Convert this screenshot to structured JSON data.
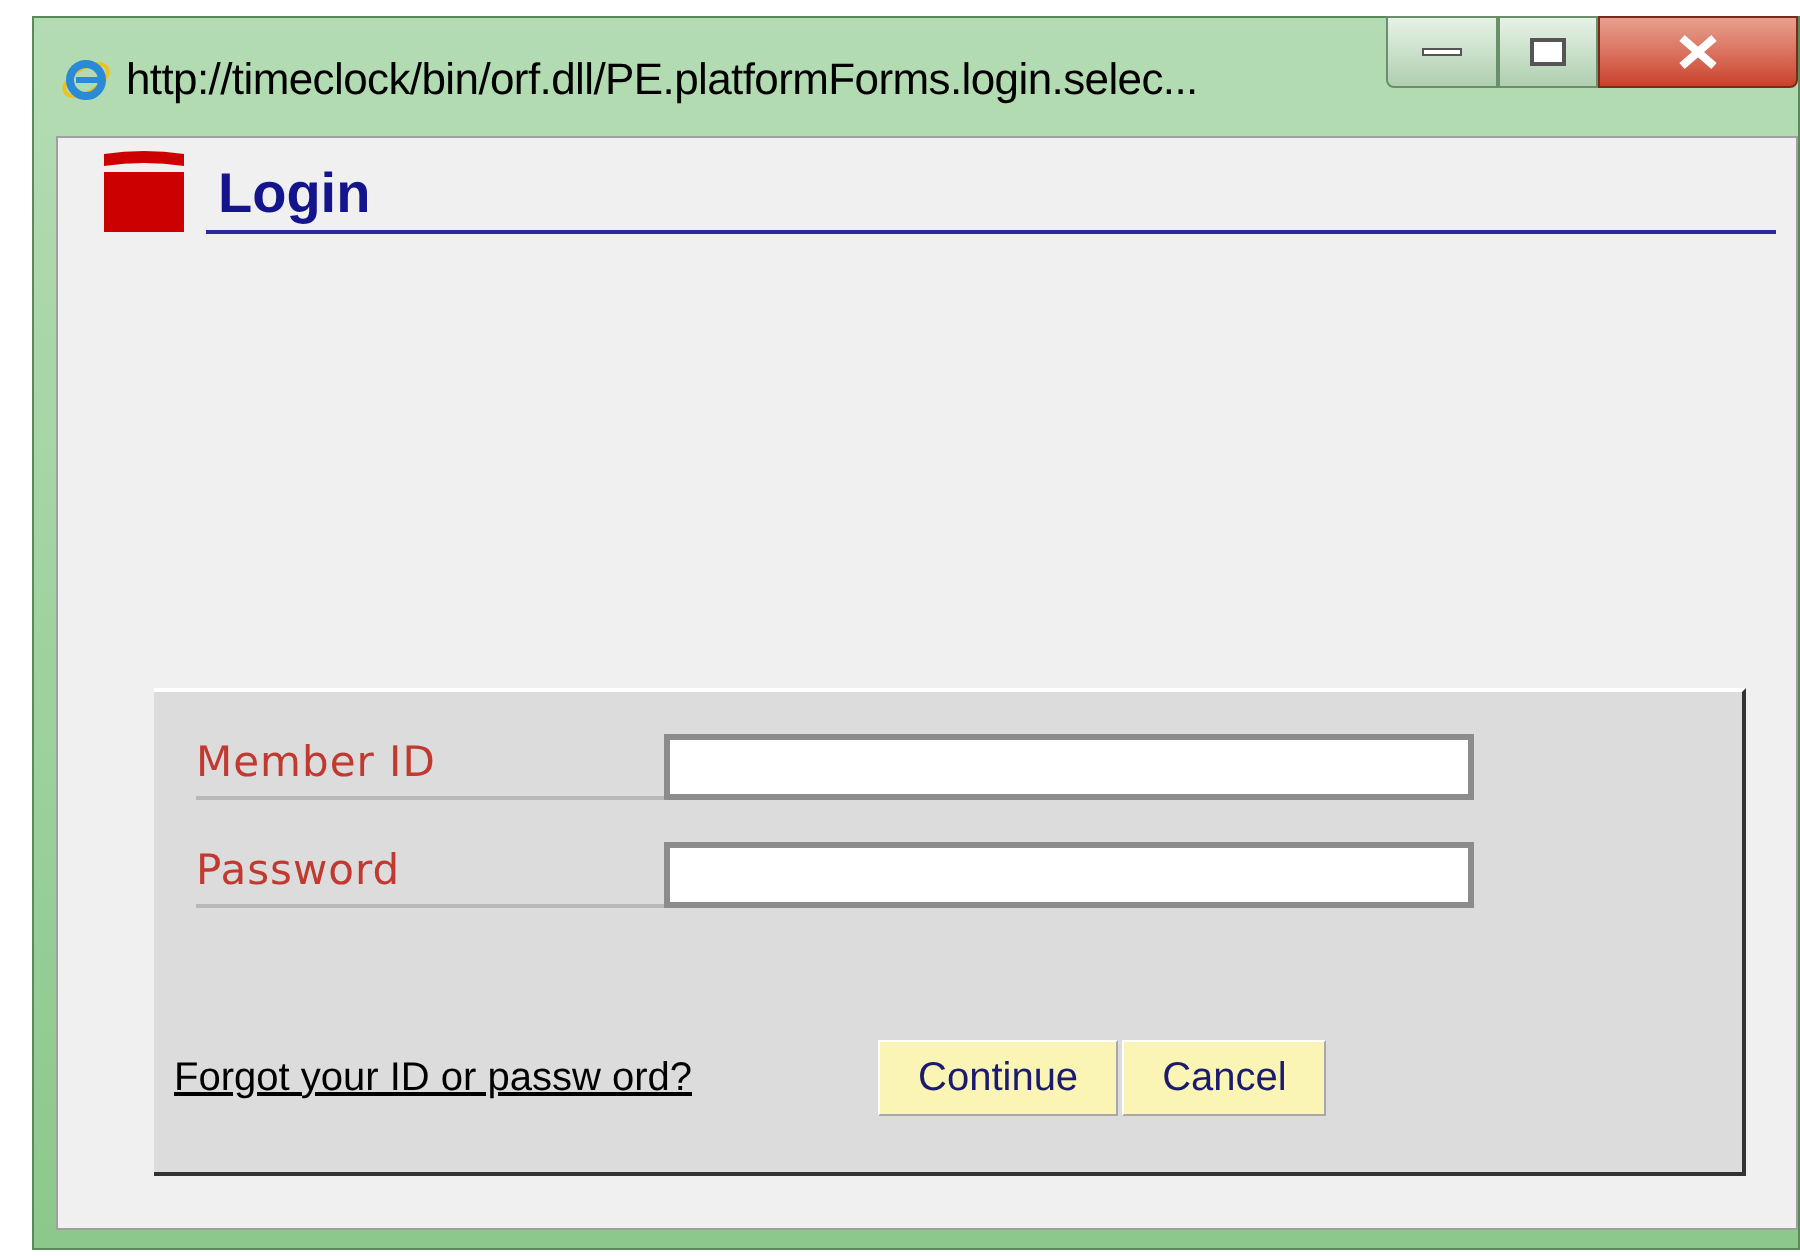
{
  "window": {
    "title": "http://timeclock/bin/orf.dll/PE.platformForms.login.selec..."
  },
  "page": {
    "heading": "Login"
  },
  "form": {
    "fields": [
      {
        "label": "Member ID"
      },
      {
        "label": "Password"
      }
    ],
    "forgot_link": "Forgot your ID or passw ord?",
    "buttons": [
      "Continue",
      "Cancel"
    ]
  }
}
